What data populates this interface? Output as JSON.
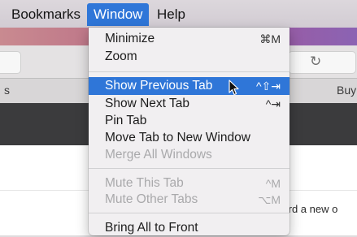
{
  "menubar": {
    "items": [
      {
        "label": "Bookmarks",
        "active": false
      },
      {
        "label": "Window",
        "active": true
      },
      {
        "label": "Help",
        "active": false
      }
    ]
  },
  "background": {
    "tab_left_fragment": "s",
    "tab_right_fragment": "Buy",
    "content_text": "ward a new o",
    "reload_icon": "↻"
  },
  "window_menu": {
    "items": [
      {
        "label": "Minimize",
        "shortcut": "⌘M",
        "state": "normal"
      },
      {
        "label": "Zoom",
        "shortcut": "",
        "state": "normal"
      },
      {
        "label": "Show Previous Tab",
        "shortcut": "^⇧⇥",
        "state": "highlighted"
      },
      {
        "label": "Show Next Tab",
        "shortcut": "^⇥",
        "state": "normal"
      },
      {
        "label": "Pin Tab",
        "shortcut": "",
        "state": "normal"
      },
      {
        "label": "Move Tab to New Window",
        "shortcut": "",
        "state": "normal"
      },
      {
        "label": "Merge All Windows",
        "shortcut": "",
        "state": "disabled"
      },
      {
        "label": "Mute This Tab",
        "shortcut": "^M",
        "state": "disabled"
      },
      {
        "label": "Mute Other Tabs",
        "shortcut": "⌥M",
        "state": "disabled"
      },
      {
        "label": "Bring All to Front",
        "shortcut": "",
        "state": "normal"
      }
    ]
  },
  "colors": {
    "highlight": "#2f76d8",
    "disabled_text": "#a9a9ab",
    "menu_background": "#f1eff1"
  }
}
